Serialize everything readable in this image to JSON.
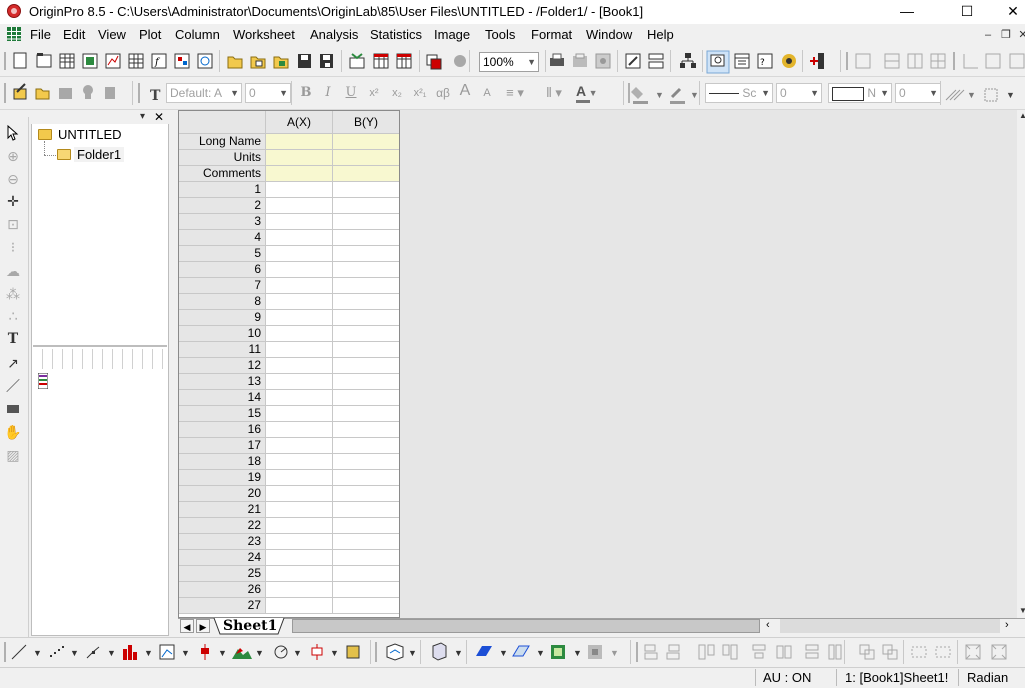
{
  "titlebar": {
    "title": "OriginPro 8.5 - C:\\Users\\Administrator\\Documents\\OriginLab\\85\\User Files\\UNTITLED - /Folder1/ - [Book1]",
    "minimize": "—",
    "maximize": "☐",
    "close": "✕"
  },
  "menu": {
    "items": [
      "File",
      "Edit",
      "View",
      "Plot",
      "Column",
      "Worksheet",
      "Analysis",
      "Statistics",
      "Image",
      "Tools",
      "Format",
      "Window",
      "Help"
    ]
  },
  "toolbar2": {
    "zoom": "100%"
  },
  "toolbar3": {
    "font_name": "Default: A",
    "font_size": "0",
    "line_style": "Sc",
    "line_width": "0",
    "fill_label": "N",
    "fill_width": "0",
    "bold": "B",
    "italic": "I",
    "underline": "U",
    "superscript": "x²",
    "subscript": "x₂",
    "supsub": "x²₁",
    "greek": "αβ",
    "grow_font": "A",
    "shrink_font": "A"
  },
  "explorer": {
    "root": "UNTITLED",
    "child": "Folder1",
    "close": "✕"
  },
  "worksheet": {
    "columns": [
      "A(X)",
      "B(Y)"
    ],
    "label_rows": [
      "Long Name",
      "Units",
      "Comments"
    ],
    "rows": [
      "1",
      "2",
      "3",
      "4",
      "5",
      "6",
      "7",
      "8",
      "9",
      "10",
      "11",
      "12",
      "13",
      "14",
      "15",
      "16",
      "17",
      "18",
      "19",
      "20",
      "21",
      "22",
      "23",
      "24",
      "25",
      "26",
      "27"
    ],
    "sheet_tab": "Sheet1"
  },
  "status": {
    "au": "AU : ON",
    "active": "1: [Book1]Sheet1!",
    "angle": "Radian"
  }
}
